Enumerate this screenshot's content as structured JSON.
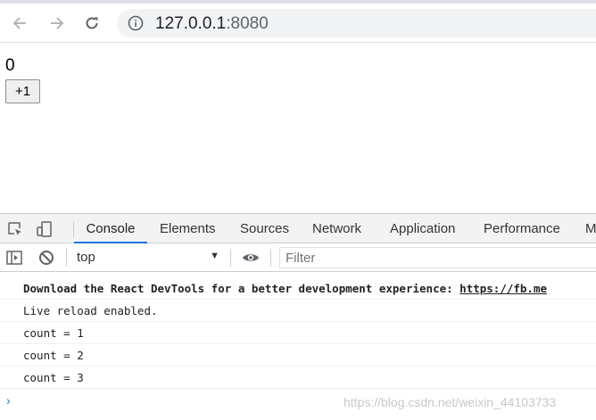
{
  "browser": {
    "url_host": "127.0.0.1",
    "url_port": ":8080"
  },
  "page": {
    "count_value": "0",
    "increment_label": "+1"
  },
  "devtools": {
    "tabs": [
      "Console",
      "Elements",
      "Sources",
      "Network",
      "Application",
      "Performance",
      "M"
    ],
    "active_tab": "Console",
    "context": "top",
    "filter_placeholder": "Filter",
    "messages": {
      "devtools_notice": "Download the React DevTools for a better development experience: ",
      "devtools_link": "https://fb.me",
      "live_reload": "Live reload enabled.",
      "count1": "count = 1",
      "count2": "count = 2",
      "count3": "count = 3"
    },
    "prompt_symbol": "›"
  },
  "watermark": "https://blog.csdn.net/weixin_44103733",
  "colors": {
    "accent": "#1a73e8",
    "toolbar_bg": "#f3f3f3"
  }
}
